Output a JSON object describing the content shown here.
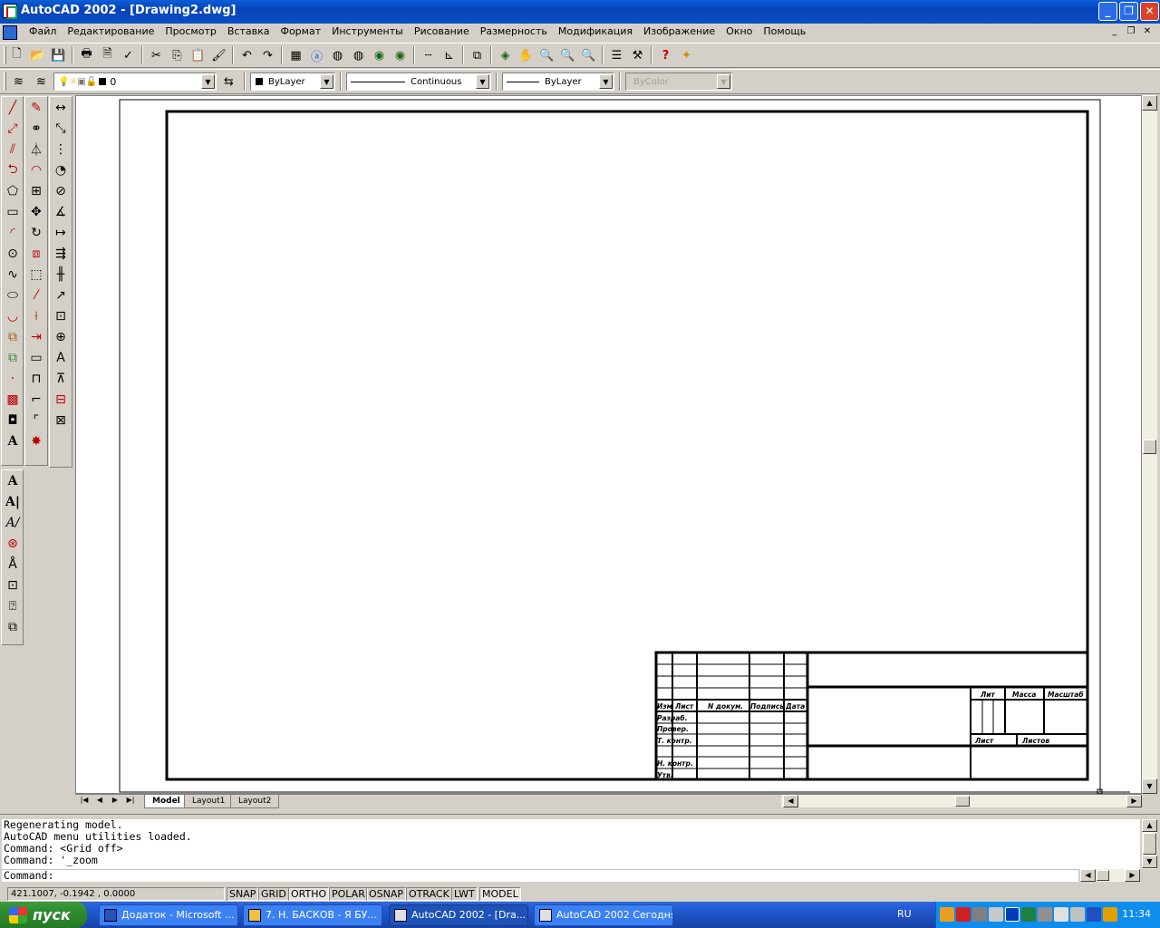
{
  "window": {
    "title": "AutoCAD 2002 - [Drawing2.dwg]"
  },
  "menu": [
    "Файл",
    "Редактирование",
    "Просмотр",
    "Вставка",
    "Формат",
    "Инструменты",
    "Рисование",
    "Размерность",
    "Модификация",
    "Изображение",
    "Окно",
    "Помощь"
  ],
  "layer_toolbar": {
    "layer_value": "0",
    "color_value": "ByLayer",
    "linetype_value": "Continuous",
    "lineweight_value": "ByLayer",
    "plotstyle_value": "ByColor"
  },
  "layout_tabs": [
    "Model",
    "Layout1",
    "Layout2"
  ],
  "title_block": {
    "izm": "Изм",
    "list": "Лист",
    "n_dokum": "N докум.",
    "podpis": "Подпись",
    "data": "Дата",
    "razrab": "Разраб.",
    "proverl": "Провер.",
    "t_kontr": "Т. контр.",
    "n_kontr": "Н. контр.",
    "utv": "Утв.",
    "lit": "Лит",
    "massa": "Масса",
    "masshtab": "Масштаб",
    "list2": "Лист",
    "listov": "Листов"
  },
  "command_window": {
    "history": [
      "Regenerating model.",
      "AutoCAD menu utilities loaded.",
      "Command:  <Grid off>",
      "Command: '_zoom"
    ],
    "prompt": "Command:"
  },
  "status": {
    "coords": "421.1007, -0.1942 , 0.0000",
    "toggles": [
      "SNAP",
      "GRID",
      "ORTHO",
      "POLAR",
      "OSNAP",
      "OTRACK",
      "LWT",
      "MODEL"
    ]
  },
  "taskbar": {
    "start_label": "пуск",
    "tasks": [
      "Додаток - Microsoft ...",
      "7. Н. БАСКОВ - Я БУ...",
      "AutoCAD 2002 - [Dra...",
      "AutoCAD 2002 Сегодня"
    ],
    "language": "RU",
    "clock": "11:34"
  },
  "colors": {
    "titlebar": "#0a4ec4",
    "taskbar": "#245dda",
    "start": "#2f8a2f",
    "drawing_bg": "#ffffff"
  }
}
